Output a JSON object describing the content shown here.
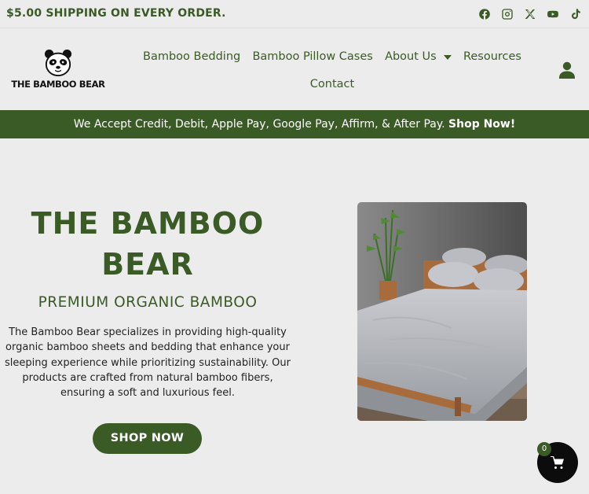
{
  "topbar": {
    "promo": "$5.00 SHIPPING ON EVERY ORDER.",
    "socials": [
      "facebook-icon",
      "instagram-icon",
      "x-icon",
      "youtube-icon",
      "tiktok-icon"
    ]
  },
  "header": {
    "logo_text": "THE BAMBOO BEAR",
    "nav": {
      "bedding": "Bamboo Bedding",
      "pillow_cases": "Bamboo Pillow Cases",
      "about": "About Us",
      "resources": "Resources",
      "contact": "Contact"
    },
    "account_icon": "user-icon"
  },
  "banner": {
    "text": "We Accept Credit, Debit, Apple Pay, Google Pay, Affirm, & After Pay.",
    "cta": "Shop Now!"
  },
  "hero": {
    "title": "THE BAMBOO BEAR",
    "subtitle": "PREMIUM ORGANIC BAMBOO",
    "description": "The Bamboo Bear specializes in providing high-quality organic bamboo sheets and bedding that enhance your sleeping experience while prioritizing sustainability. Our products are crafted from natural bamboo fibers, ensuring a soft and luxurious feel.",
    "button": "SHOP NOW"
  },
  "cart": {
    "count": "0",
    "icon": "cart-icon"
  },
  "colors": {
    "brand_green": "#3a5a26",
    "background": "#ececec",
    "cart_bg": "#0c0c0c"
  }
}
